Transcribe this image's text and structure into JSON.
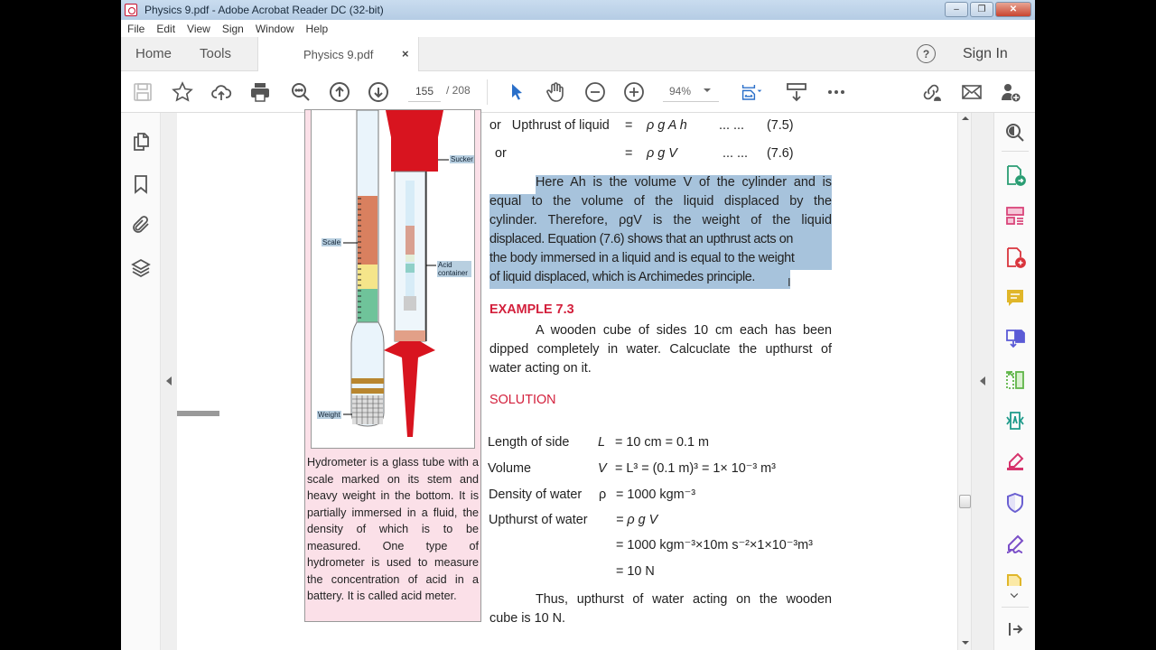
{
  "window": {
    "title": "Physics 9.pdf - Adobe Acrobat Reader DC (32-bit)",
    "minimize": "–",
    "restore": "❐",
    "close": "✕"
  },
  "menu": [
    "File",
    "Edit",
    "View",
    "Sign",
    "Window",
    "Help"
  ],
  "tabs": {
    "home": "Home",
    "tools": "Tools",
    "document": "Physics 9.pdf",
    "close": "×",
    "help": "?",
    "sign_in": "Sign In"
  },
  "toolbar": {
    "current_page": "155",
    "total_pages": "/  208",
    "zoom": "94%",
    "icons": [
      "save-icon",
      "bookmark-star-icon",
      "upload-cloud-icon",
      "print-icon",
      "find-icon",
      "page-up-icon",
      "page-down-icon",
      "select-cursor-icon",
      "hand-tool-icon",
      "zoom-out-icon",
      "zoom-in-icon",
      "fit-page-icon",
      "scroll-mode-icon",
      "more-icon",
      "share-link-icon",
      "email-icon",
      "add-user-icon"
    ]
  },
  "left_rail": [
    "page-thumbnails-icon",
    "bookmarks-icon",
    "attachments-icon",
    "layers-icon"
  ],
  "right_rail": [
    "enhance-scan-icon",
    "export-pdf-icon",
    "organize-pages-icon",
    "create-pdf-icon",
    "comment-icon",
    "combine-files-icon",
    "compress-icon",
    "protect-scan-icon",
    "fill-sign-icon",
    "protect-icon",
    "sign-icon",
    "edit-pdf-icon"
  ],
  "figure": {
    "labels": {
      "sucker": "Sucker",
      "scale": "Scale",
      "acid_container": "Acid container",
      "weight": "Weight"
    },
    "caption": "Hydrometer is a glass tube with a scale marked on its stem and heavy weight in the bottom. It is partially immersed in a fluid, the density of which is to be measured. One type of hydrometer is used to measure the concentration of acid in a battery. It is called acid meter."
  },
  "content": {
    "eq1": {
      "prefix": "or",
      "label": "Upthrust of liquid",
      "eq": "=",
      "expr": "ρ g A h",
      "dots": "...      ...",
      "num": "(7.5)"
    },
    "eq2": {
      "prefix": "or",
      "eq": "=",
      "expr": "ρ g V",
      "dots": "...      ...",
      "num": "(7.6)"
    },
    "paragraph_lines": [
      "Here Ah is the volume V of the cylinder and is",
      "equal to the volume of the liquid displaced by the",
      "cylinder. Therefore, ρgV is the weight of the liquid",
      "displaced. Equation (7.6) shows that an upthrust acts on",
      "the body immersed in a liquid and is equal to the weight",
      "of liquid displaced, which is  Archimedes principle."
    ],
    "example_heading": "EXAMPLE 7.3",
    "example_lines": [
      "A wooden cube of sides 10 cm each has been",
      "dipped completely in water. Calcuclate the upthurst of",
      "water acting on it."
    ],
    "solution_heading": "SOLUTION",
    "solution": {
      "length_label": "Length of side",
      "length_sym": "L",
      "length_val": "= 10 cm  = 0.1 m",
      "volume_label": "Volume",
      "volume_sym": "V",
      "volume_val": "= L³  = (0.1 m)³   = 1× 10⁻³ m³",
      "density_label": "Density of water",
      "density_sym": "ρ",
      "density_val": "= 1000 kgm⁻³",
      "upthrust_label": "Upthurst of water",
      "upthrust_val1": "= ρ g V",
      "upthrust_val2": "= 1000 kgm⁻³×10m s⁻²×1×10⁻³m³",
      "upthrust_val3": "= 10 N"
    },
    "conclusion_lines": [
      "Thus, upthurst of water acting on the wooden",
      "cube is 10 N."
    ]
  }
}
